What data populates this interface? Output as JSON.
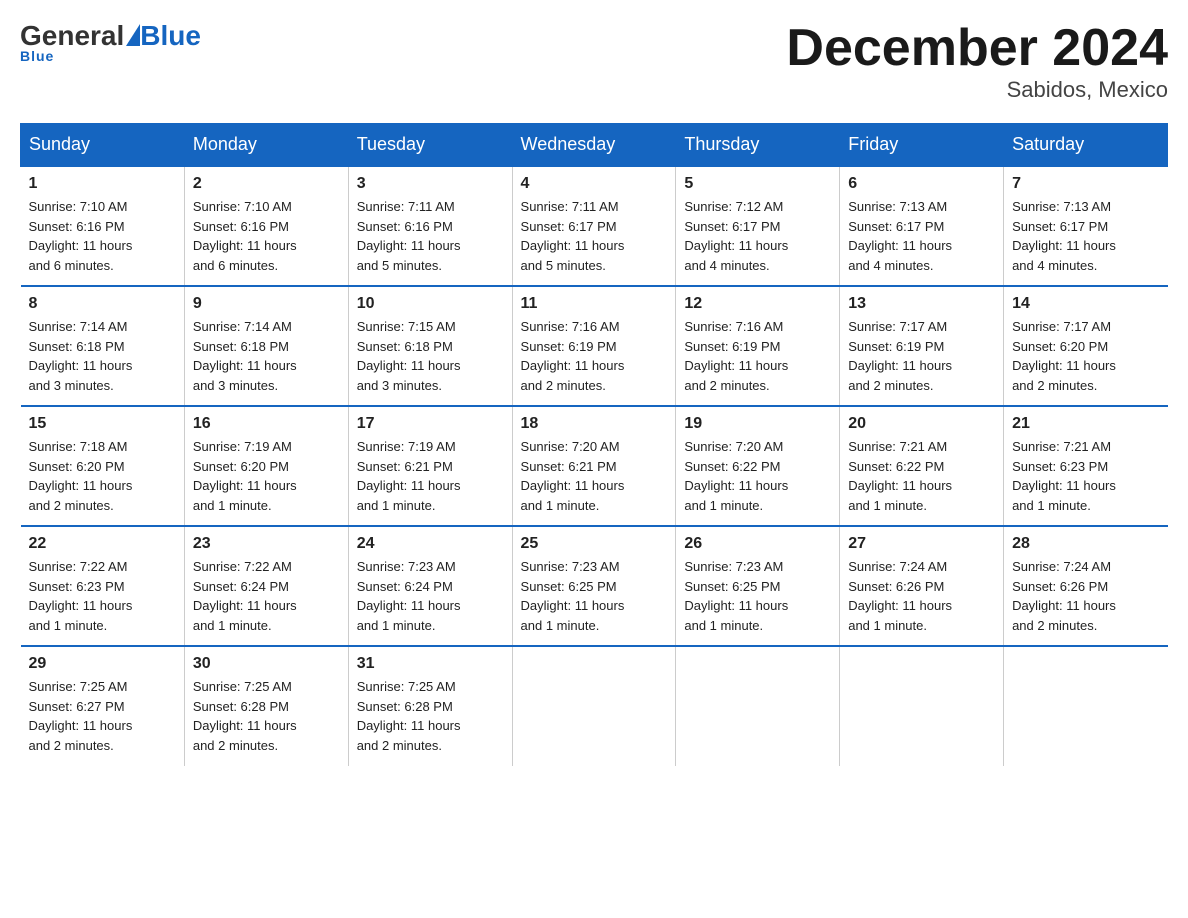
{
  "header": {
    "logo": {
      "general": "General",
      "triangle": "",
      "blue": "Blue",
      "underline": "Blue"
    },
    "title": "December 2024",
    "location": "Sabidos, Mexico"
  },
  "days_of_week": [
    "Sunday",
    "Monday",
    "Tuesday",
    "Wednesday",
    "Thursday",
    "Friday",
    "Saturday"
  ],
  "weeks": [
    [
      {
        "day": "1",
        "info": "Sunrise: 7:10 AM\nSunset: 6:16 PM\nDaylight: 11 hours\nand 6 minutes."
      },
      {
        "day": "2",
        "info": "Sunrise: 7:10 AM\nSunset: 6:16 PM\nDaylight: 11 hours\nand 6 minutes."
      },
      {
        "day": "3",
        "info": "Sunrise: 7:11 AM\nSunset: 6:16 PM\nDaylight: 11 hours\nand 5 minutes."
      },
      {
        "day": "4",
        "info": "Sunrise: 7:11 AM\nSunset: 6:17 PM\nDaylight: 11 hours\nand 5 minutes."
      },
      {
        "day": "5",
        "info": "Sunrise: 7:12 AM\nSunset: 6:17 PM\nDaylight: 11 hours\nand 4 minutes."
      },
      {
        "day": "6",
        "info": "Sunrise: 7:13 AM\nSunset: 6:17 PM\nDaylight: 11 hours\nand 4 minutes."
      },
      {
        "day": "7",
        "info": "Sunrise: 7:13 AM\nSunset: 6:17 PM\nDaylight: 11 hours\nand 4 minutes."
      }
    ],
    [
      {
        "day": "8",
        "info": "Sunrise: 7:14 AM\nSunset: 6:18 PM\nDaylight: 11 hours\nand 3 minutes."
      },
      {
        "day": "9",
        "info": "Sunrise: 7:14 AM\nSunset: 6:18 PM\nDaylight: 11 hours\nand 3 minutes."
      },
      {
        "day": "10",
        "info": "Sunrise: 7:15 AM\nSunset: 6:18 PM\nDaylight: 11 hours\nand 3 minutes."
      },
      {
        "day": "11",
        "info": "Sunrise: 7:16 AM\nSunset: 6:19 PM\nDaylight: 11 hours\nand 2 minutes."
      },
      {
        "day": "12",
        "info": "Sunrise: 7:16 AM\nSunset: 6:19 PM\nDaylight: 11 hours\nand 2 minutes."
      },
      {
        "day": "13",
        "info": "Sunrise: 7:17 AM\nSunset: 6:19 PM\nDaylight: 11 hours\nand 2 minutes."
      },
      {
        "day": "14",
        "info": "Sunrise: 7:17 AM\nSunset: 6:20 PM\nDaylight: 11 hours\nand 2 minutes."
      }
    ],
    [
      {
        "day": "15",
        "info": "Sunrise: 7:18 AM\nSunset: 6:20 PM\nDaylight: 11 hours\nand 2 minutes."
      },
      {
        "day": "16",
        "info": "Sunrise: 7:19 AM\nSunset: 6:20 PM\nDaylight: 11 hours\nand 1 minute."
      },
      {
        "day": "17",
        "info": "Sunrise: 7:19 AM\nSunset: 6:21 PM\nDaylight: 11 hours\nand 1 minute."
      },
      {
        "day": "18",
        "info": "Sunrise: 7:20 AM\nSunset: 6:21 PM\nDaylight: 11 hours\nand 1 minute."
      },
      {
        "day": "19",
        "info": "Sunrise: 7:20 AM\nSunset: 6:22 PM\nDaylight: 11 hours\nand 1 minute."
      },
      {
        "day": "20",
        "info": "Sunrise: 7:21 AM\nSunset: 6:22 PM\nDaylight: 11 hours\nand 1 minute."
      },
      {
        "day": "21",
        "info": "Sunrise: 7:21 AM\nSunset: 6:23 PM\nDaylight: 11 hours\nand 1 minute."
      }
    ],
    [
      {
        "day": "22",
        "info": "Sunrise: 7:22 AM\nSunset: 6:23 PM\nDaylight: 11 hours\nand 1 minute."
      },
      {
        "day": "23",
        "info": "Sunrise: 7:22 AM\nSunset: 6:24 PM\nDaylight: 11 hours\nand 1 minute."
      },
      {
        "day": "24",
        "info": "Sunrise: 7:23 AM\nSunset: 6:24 PM\nDaylight: 11 hours\nand 1 minute."
      },
      {
        "day": "25",
        "info": "Sunrise: 7:23 AM\nSunset: 6:25 PM\nDaylight: 11 hours\nand 1 minute."
      },
      {
        "day": "26",
        "info": "Sunrise: 7:23 AM\nSunset: 6:25 PM\nDaylight: 11 hours\nand 1 minute."
      },
      {
        "day": "27",
        "info": "Sunrise: 7:24 AM\nSunset: 6:26 PM\nDaylight: 11 hours\nand 1 minute."
      },
      {
        "day": "28",
        "info": "Sunrise: 7:24 AM\nSunset: 6:26 PM\nDaylight: 11 hours\nand 2 minutes."
      }
    ],
    [
      {
        "day": "29",
        "info": "Sunrise: 7:25 AM\nSunset: 6:27 PM\nDaylight: 11 hours\nand 2 minutes."
      },
      {
        "day": "30",
        "info": "Sunrise: 7:25 AM\nSunset: 6:28 PM\nDaylight: 11 hours\nand 2 minutes."
      },
      {
        "day": "31",
        "info": "Sunrise: 7:25 AM\nSunset: 6:28 PM\nDaylight: 11 hours\nand 2 minutes."
      },
      null,
      null,
      null,
      null
    ]
  ]
}
